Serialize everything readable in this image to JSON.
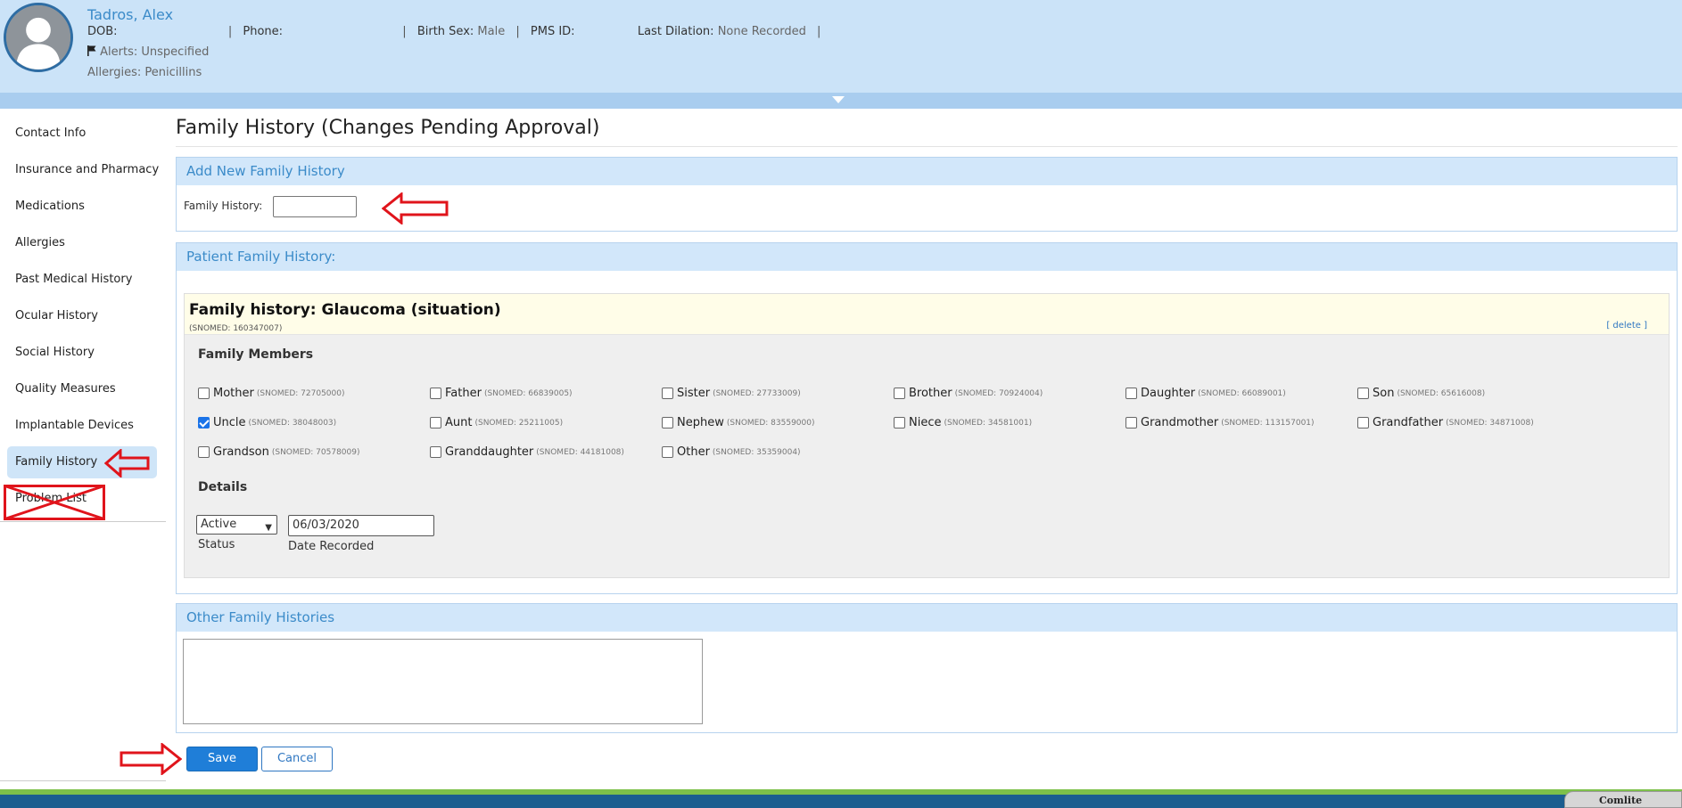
{
  "patient": {
    "name": "Tadros, Alex",
    "dob_label": "DOB:",
    "phone_label": "Phone:",
    "birth_sex_label": "Birth Sex:",
    "birth_sex_value": "Male",
    "pms_label": "PMS ID:",
    "last_dilation_label": "Last Dilation:",
    "last_dilation_value": "None Recorded",
    "alerts_label": "Alerts:",
    "alerts_value": "Unspecified",
    "allergies_label": "Allergies:",
    "allergies_value": "Penicillins",
    "separator": "|"
  },
  "sidebar": {
    "items": [
      {
        "label": "Contact Info"
      },
      {
        "label": "Insurance and Pharmacy"
      },
      {
        "label": "Medications"
      },
      {
        "label": "Allergies"
      },
      {
        "label": "Past Medical History"
      },
      {
        "label": "Ocular History"
      },
      {
        "label": "Social History"
      },
      {
        "label": "Quality Measures"
      },
      {
        "label": "Implantable Devices"
      },
      {
        "label": "Family History",
        "active": true
      },
      {
        "label": "Problem List"
      }
    ]
  },
  "main": {
    "title": "Family History (Changes Pending Approval)",
    "add_panel": {
      "heading": "Add New Family History",
      "field_label": "Family History:",
      "field_value": ""
    },
    "patient_panel": {
      "heading": "Patient Family History:",
      "condition": {
        "title": "Family history: Glaucoma (situation)",
        "snomed": "(SNOMED: 160347007)",
        "delete_label": "[ delete ]",
        "members_heading": "Family Members",
        "members": [
          {
            "label": "Mother",
            "code": "(SNOMED: 72705000)",
            "checked": false
          },
          {
            "label": "Father",
            "code": "(SNOMED: 66839005)",
            "checked": false
          },
          {
            "label": "Sister",
            "code": "(SNOMED: 27733009)",
            "checked": false
          },
          {
            "label": "Brother",
            "code": "(SNOMED: 70924004)",
            "checked": false
          },
          {
            "label": "Daughter",
            "code": "(SNOMED: 66089001)",
            "checked": false
          },
          {
            "label": "Son",
            "code": "(SNOMED: 65616008)",
            "checked": false
          },
          {
            "label": "Uncle",
            "code": "(SNOMED: 38048003)",
            "checked": true
          },
          {
            "label": "Aunt",
            "code": "(SNOMED: 25211005)",
            "checked": false
          },
          {
            "label": "Nephew",
            "code": "(SNOMED: 83559000)",
            "checked": false
          },
          {
            "label": "Niece",
            "code": "(SNOMED: 34581001)",
            "checked": false
          },
          {
            "label": "Grandmother",
            "code": "(SNOMED: 113157001)",
            "checked": false
          },
          {
            "label": "Grandfather",
            "code": "(SNOMED: 34871008)",
            "checked": false
          },
          {
            "label": "Grandson",
            "code": "(SNOMED: 70578009)",
            "checked": false
          },
          {
            "label": "Granddaughter",
            "code": "(SNOMED: 44181008)",
            "checked": false
          },
          {
            "label": "Other",
            "code": "(SNOMED: 35359004)",
            "checked": false
          }
        ],
        "details_heading": "Details",
        "status_value": "Active",
        "status_label": "Status",
        "date_value": "06/03/2020",
        "date_label": "Date Recorded"
      }
    },
    "other_panel": {
      "heading": "Other Family Histories",
      "text": ""
    },
    "save_label": "Save",
    "cancel_label": "Cancel"
  },
  "footer": {
    "tab_label": "Comlite"
  },
  "colors": {
    "header_bg": "#cbe3f8",
    "accent_blue": "#3b8bc9",
    "save_button": "#1f7ed8",
    "annotation_red": "#e0141b"
  }
}
